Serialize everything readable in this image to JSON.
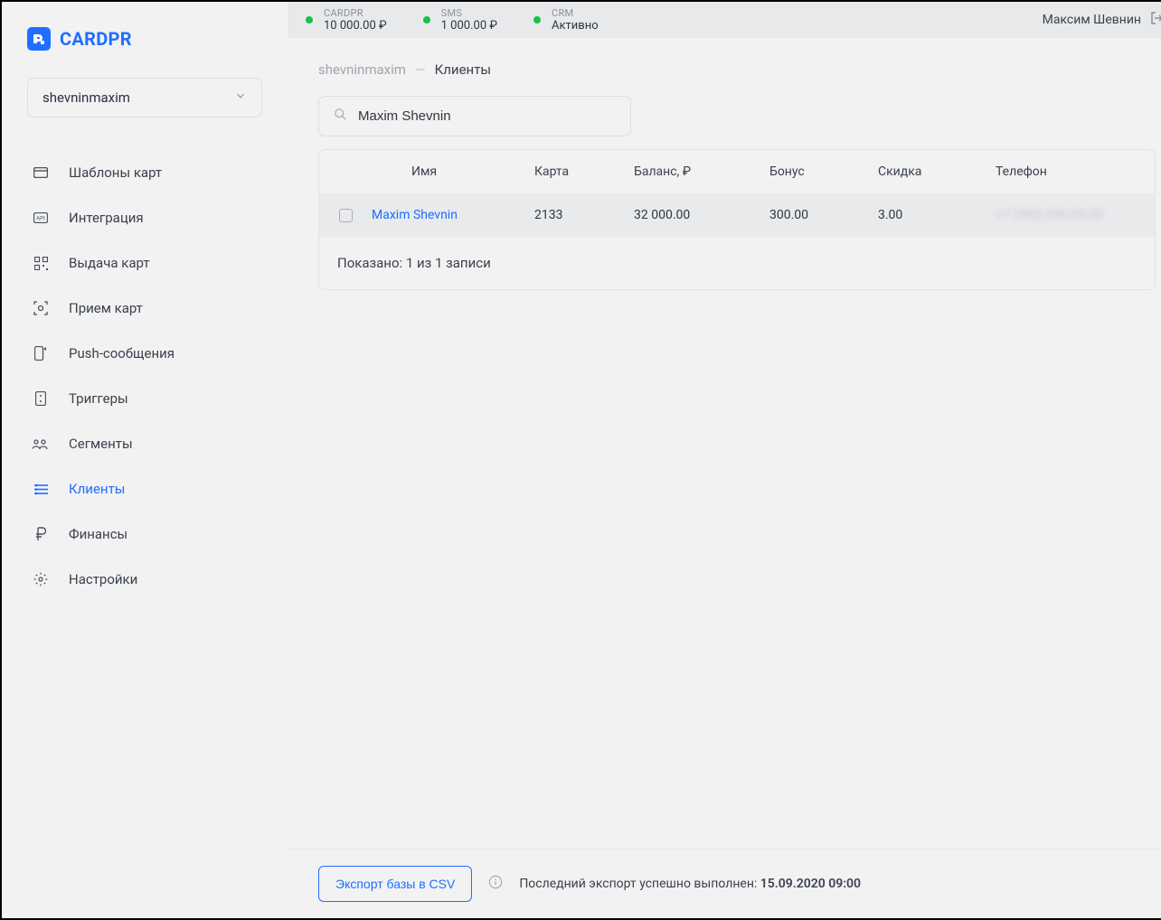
{
  "brand": "CARDPR",
  "account_selector": {
    "value": "shevninmaxim"
  },
  "sidebar": {
    "items": [
      {
        "label": "Шаблоны карт"
      },
      {
        "label": "Интеграция"
      },
      {
        "label": "Выдача карт"
      },
      {
        "label": "Прием карт"
      },
      {
        "label": "Push-сообщения"
      },
      {
        "label": "Триггеры"
      },
      {
        "label": "Сегменты"
      },
      {
        "label": "Клиенты"
      },
      {
        "label": "Финансы"
      },
      {
        "label": "Настройки"
      }
    ]
  },
  "topbar": {
    "statuses": [
      {
        "label": "CARDPR",
        "value": "10 000.00 ₽"
      },
      {
        "label": "SMS",
        "value": "1 000.00 ₽"
      },
      {
        "label": "CRM",
        "value": "Активно"
      }
    ],
    "user_name": "Максим Шевнин"
  },
  "breadcrumb": {
    "root": "shevninmaxim",
    "current": "Клиенты"
  },
  "search": {
    "value": "Maxim Shevnin"
  },
  "table": {
    "headers": {
      "name": "Имя",
      "card": "Карта",
      "balance": "Баланс, ₽",
      "bonus": "Бонус",
      "discount": "Скидка",
      "phone": "Телефон"
    },
    "rows": [
      {
        "name": "Maxim Shevnin",
        "card": "2133",
        "balance": "32 000.00",
        "bonus": "300.00",
        "discount": "3.00",
        "phone": "+7 (900) 000-00-00"
      }
    ],
    "footer_text": "Показано: 1 из 1 записи"
  },
  "footer": {
    "export_label": "Экспорт базы в CSV",
    "status_prefix": "Последний экспорт успешно выполнен: ",
    "status_date": "15.09.2020 09:00"
  }
}
